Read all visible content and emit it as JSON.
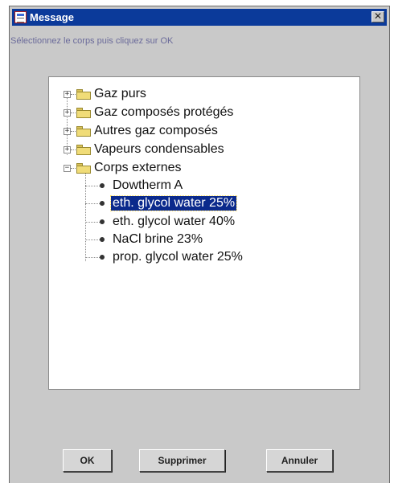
{
  "window": {
    "title": "Message",
    "close_glyph": "✕"
  },
  "instruction": "Sélectionnez le corps puis cliquez sur OK",
  "tree": {
    "folders": [
      {
        "label": "Gaz purs",
        "expander": "+"
      },
      {
        "label": "Gaz composés protégés",
        "expander": "+"
      },
      {
        "label": "Autres gaz composés",
        "expander": "+"
      },
      {
        "label": "Vapeurs condensables",
        "expander": "+"
      },
      {
        "label": "Corps externes",
        "expander": "−"
      }
    ],
    "items": [
      {
        "label": "Dowtherm A",
        "selected": false
      },
      {
        "label": "eth. glycol water 25%",
        "selected": true
      },
      {
        "label": "eth. glycol water 40%",
        "selected": false
      },
      {
        "label": "NaCl brine 23%",
        "selected": false
      },
      {
        "label": "prop. glycol water 25%",
        "selected": false
      }
    ]
  },
  "buttons": {
    "ok": "OK",
    "delete": "Supprimer",
    "cancel": "Annuler"
  },
  "colors": {
    "titlebar": "#0b3a9a",
    "selection": "#0b2a8c",
    "dialog_bg": "#c9c9c9"
  },
  "icons": {
    "window": "message-window-icon",
    "close": "close-icon",
    "folder": "folder-icon",
    "leaf": "bullet-icon"
  }
}
